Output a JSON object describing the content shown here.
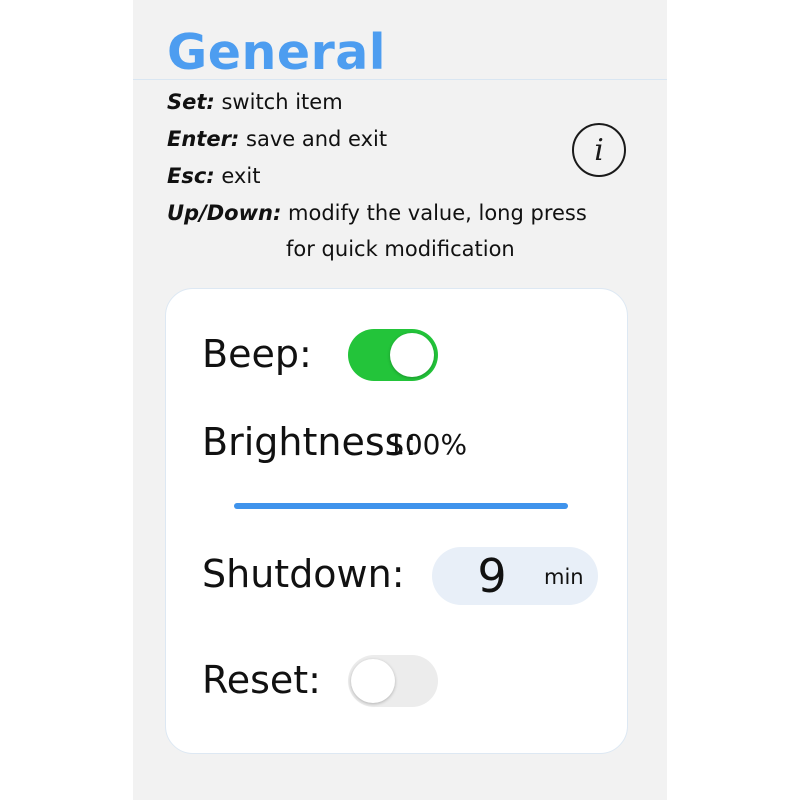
{
  "header": {
    "title": "General"
  },
  "help": {
    "set_key": "Set:",
    "set_text": " switch item",
    "enter_key": "Enter:",
    "enter_text": " save and exit",
    "esc_key": "Esc:",
    "esc_text": " exit",
    "updown_key": "Up/Down:",
    "updown_text": " modify the value, long press",
    "updown_text2": "for quick modification"
  },
  "info": {
    "icon": "info-icon",
    "glyph": "i"
  },
  "settings": {
    "beep": {
      "label": "Beep:",
      "on": true
    },
    "brightness": {
      "label": "Brightness:",
      "value_text": "100%",
      "level": 1.0
    },
    "shutdown": {
      "label": "Shutdown:",
      "value": "9",
      "unit": "min"
    },
    "reset": {
      "label": "Reset:",
      "on": false
    }
  },
  "colors": {
    "accent": "#4d9df0",
    "toggle_on": "#23c43a",
    "toggle_off": "#ececec",
    "slider": "#3f93ec",
    "background": "#f2f2f2"
  }
}
